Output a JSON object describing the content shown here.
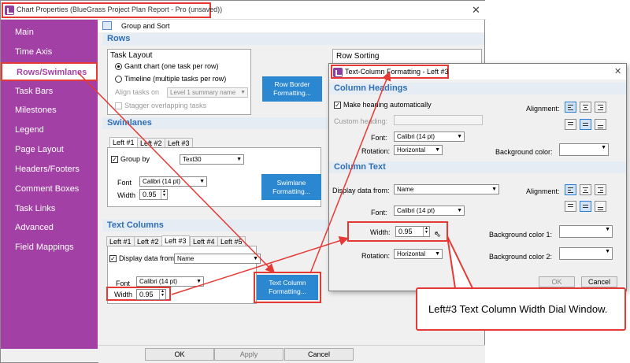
{
  "window": {
    "title": "Chart Properties (BlueGrass Project Plan Report - Pro (unsaved))",
    "close": "✕"
  },
  "sidebar": {
    "items": [
      "Main",
      "Time Axis",
      "Rows/Swimlanes",
      "Task Bars",
      "Milestones",
      "Legend",
      "Page Layout",
      "Headers/Footers",
      "Comment Boxes",
      "Task Links",
      "Advanced",
      "Field Mappings"
    ],
    "active": "Rows/Swimlanes"
  },
  "toolbar": {
    "group_sort": "Group and Sort"
  },
  "rows": {
    "header": "Rows",
    "task_layout": "Task Layout",
    "gantt_option": "Gantt chart (one task per row)",
    "timeline_option": "Timeline (multiple tasks per row)",
    "align_label": "Align tasks on",
    "align_value": "Level 1 summary name",
    "stagger": "Stagger overlapping tasks",
    "row_border_button": "Row Border Formatting...",
    "row_sorting": "Row Sorting"
  },
  "swimlanes": {
    "header": "Swimlanes",
    "tabs": [
      "Left #1",
      "Left #2",
      "Left #3"
    ],
    "group_by_label": "Group by",
    "group_by_value": "Text30",
    "font_label": "Font",
    "font_value": "Calibri (14 pt)",
    "width_label": "Width",
    "width_value": "0.95",
    "button": "Swimlane Formatting..."
  },
  "text_columns": {
    "header": "Text Columns",
    "tabs": [
      "Left #1",
      "Left #2",
      "Left #3",
      "Left #4",
      "Left #5"
    ],
    "display_label": "Display data from",
    "display_value": "Name",
    "font_label": "Font",
    "font_value": "Calibri (14 pt)",
    "width_label": "Width",
    "width_value": "0.95",
    "button": "Text Column Formatting..."
  },
  "footer": {
    "ok": "OK",
    "apply": "Apply",
    "cancel": "Cancel"
  },
  "dialog": {
    "title": "Text-Column Formatting - Left #3",
    "close": "✕",
    "headings_section": "Column Headings",
    "make_heading": "Make heading automatically",
    "custom_heading": "Custom heading:",
    "font_label": "Font:",
    "font_value": "Calibri (14 pt)",
    "rotation_label": "Rotation:",
    "rotation_value": "Horizontal",
    "alignment_label": "Alignment:",
    "bg_label": "Background color:",
    "text_section": "Column Text",
    "display_label": "Display data from:",
    "display_value": "Name",
    "text_font_value": "Calibri (14 pt)",
    "width_label": "Width:",
    "width_value": "0.95",
    "text_rotation_value": "Horizontal",
    "bg1_label": "Background color 1:",
    "bg2_label": "Background color 2:",
    "ok": "OK",
    "cancel": "Cancel"
  },
  "callout": {
    "text": "Left#3 Text Column Width Dial Window."
  },
  "colors": {
    "sidebar": "#a340a6",
    "accent_red": "#e53935",
    "button_blue": "#2a87d0",
    "section_blue": "#2f6fb5"
  }
}
